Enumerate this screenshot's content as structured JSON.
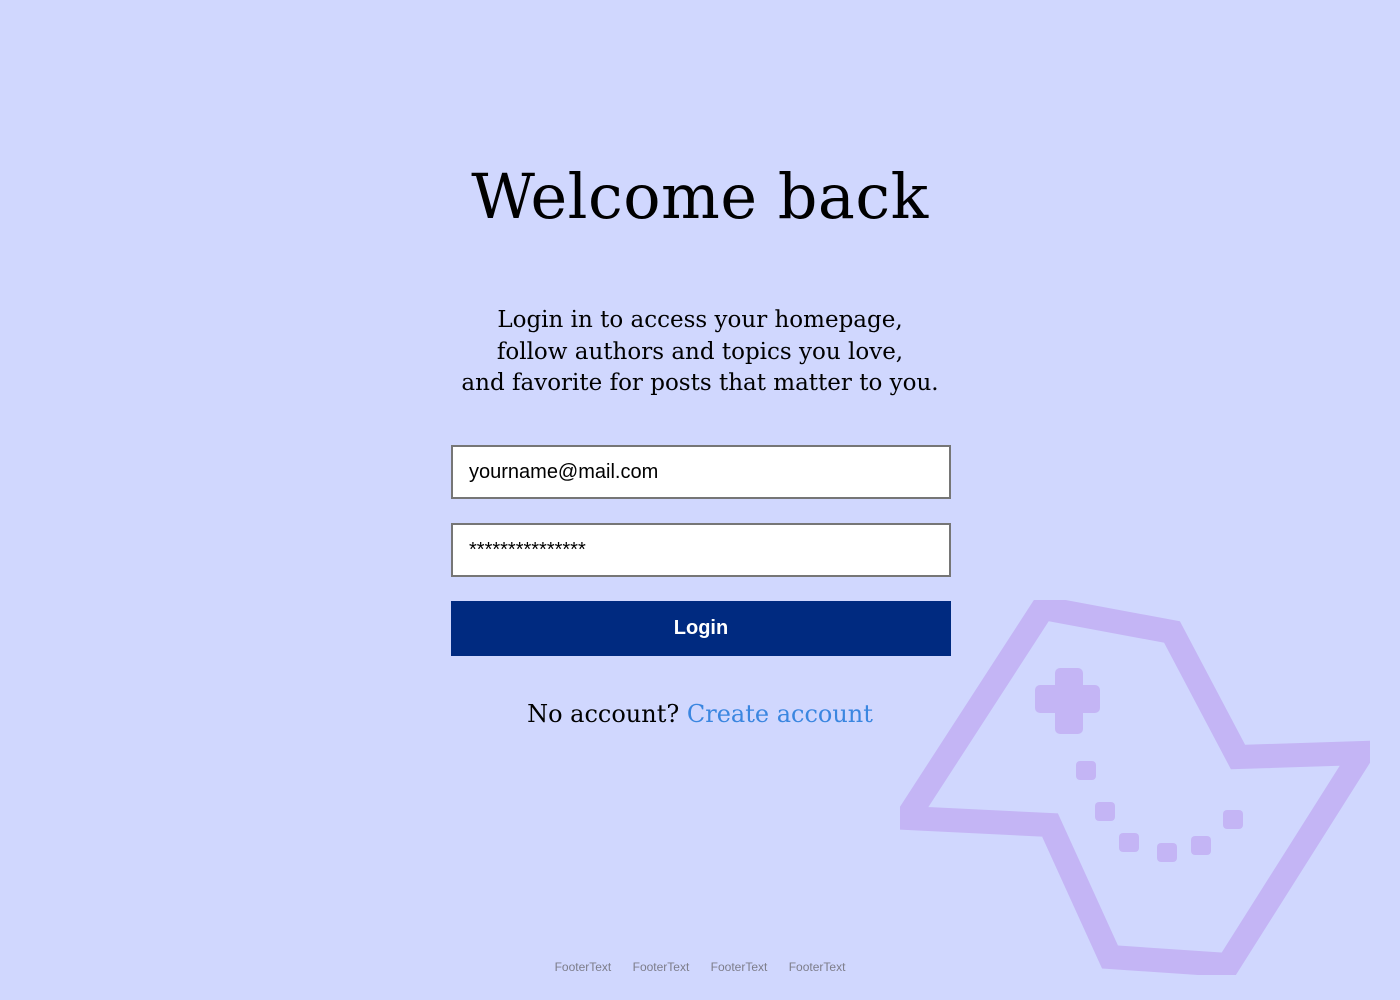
{
  "title": "Welcome back",
  "intro": {
    "line1": "Login in to access your homepage,",
    "line2": "follow authors and topics you love,",
    "line3": "and favorite for posts that matter to you."
  },
  "form": {
    "email_value": "yourname@mail.com",
    "password_value": "***************",
    "login_label": "Login"
  },
  "signup": {
    "prompt": "No account?",
    "link_label": "Create account"
  },
  "footer": {
    "links": [
      "FooterText",
      "FooterText",
      "FooterText",
      "FooterText"
    ]
  },
  "decoration": {
    "icon": "game-map-icon",
    "color": "#c4b5f5"
  },
  "colors": {
    "background": "#d0d7fe",
    "button": "#002a80",
    "link": "#3a86e0"
  }
}
